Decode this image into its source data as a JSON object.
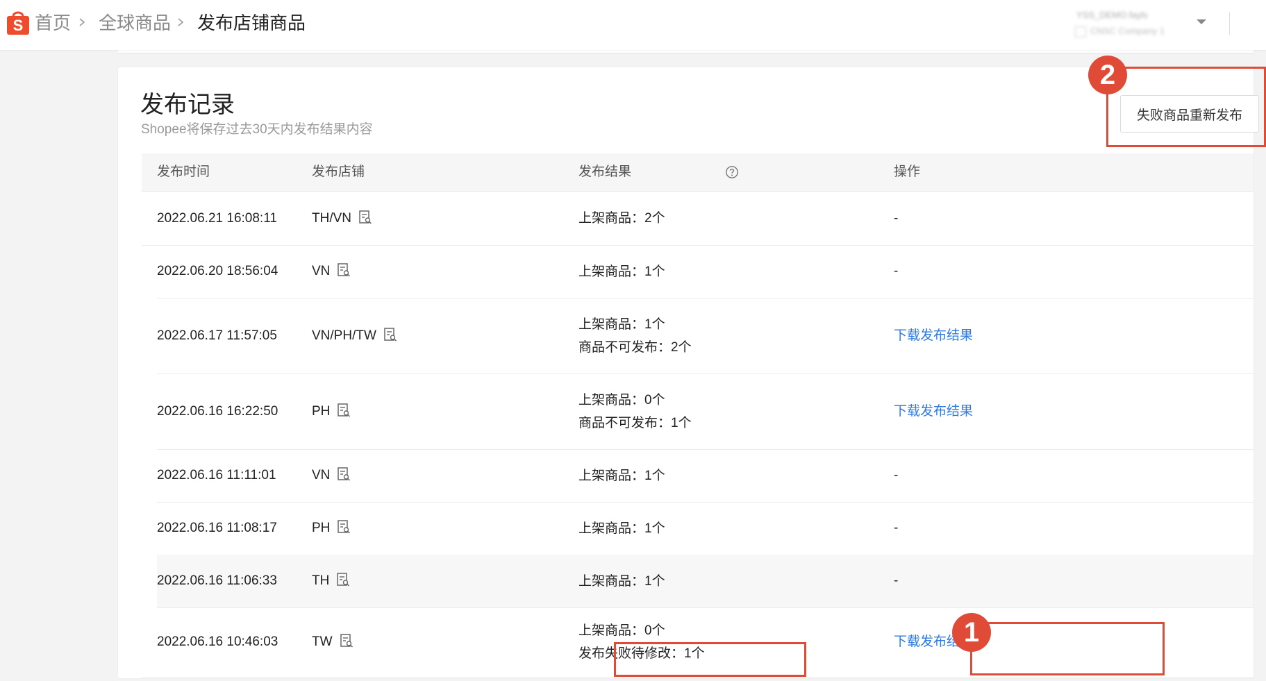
{
  "breadcrumb": {
    "home": "首页",
    "global": "全球商品",
    "current": "发布店铺商品"
  },
  "account": {
    "name": "YSS_DEMO.fayls",
    "company": "CNSC Company 1"
  },
  "card": {
    "title": "发布记录",
    "subtitle": "Shopee将保存过去30天内发布结果内容",
    "retry_button": "失败商品重新发布"
  },
  "table": {
    "headers": {
      "time": "发布时间",
      "shop": "发布店铺",
      "result": "发布结果",
      "action": "操作"
    },
    "rows": [
      {
        "time": "2022.06.21 16:08:11",
        "shop": "TH/VN",
        "results": [
          "上架商品：2个"
        ],
        "action": "-"
      },
      {
        "time": "2022.06.20 18:56:04",
        "shop": "VN",
        "results": [
          "上架商品：1个"
        ],
        "action": "-"
      },
      {
        "time": "2022.06.17 11:57:05",
        "shop": "VN/PH/TW",
        "results": [
          "上架商品：1个",
          "商品不可发布：2个"
        ],
        "action": "下载发布结果"
      },
      {
        "time": "2022.06.16 16:22:50",
        "shop": "PH",
        "results": [
          "上架商品：0个",
          "商品不可发布：1个"
        ],
        "action": "下载发布结果"
      },
      {
        "time": "2022.06.16 11:11:01",
        "shop": "VN",
        "results": [
          "上架商品：1个"
        ],
        "action": "-"
      },
      {
        "time": "2022.06.16 11:08:17",
        "shop": "PH",
        "results": [
          "上架商品：1个"
        ],
        "action": "-"
      },
      {
        "time": "2022.06.16 11:06:33",
        "shop": "TH",
        "results": [
          "上架商品：1个"
        ],
        "action": "-"
      },
      {
        "time": "2022.06.16 10:46:03",
        "shop": "TW",
        "results": [
          "上架商品：0个",
          "发布失败待修改：1个"
        ],
        "action": "下载发布结果"
      }
    ]
  },
  "annotations": {
    "badge_1": "1",
    "badge_2": "2",
    "color": "#e04b38"
  },
  "colors": {
    "brand": "#ee4d2d",
    "link": "#2c7be5"
  }
}
